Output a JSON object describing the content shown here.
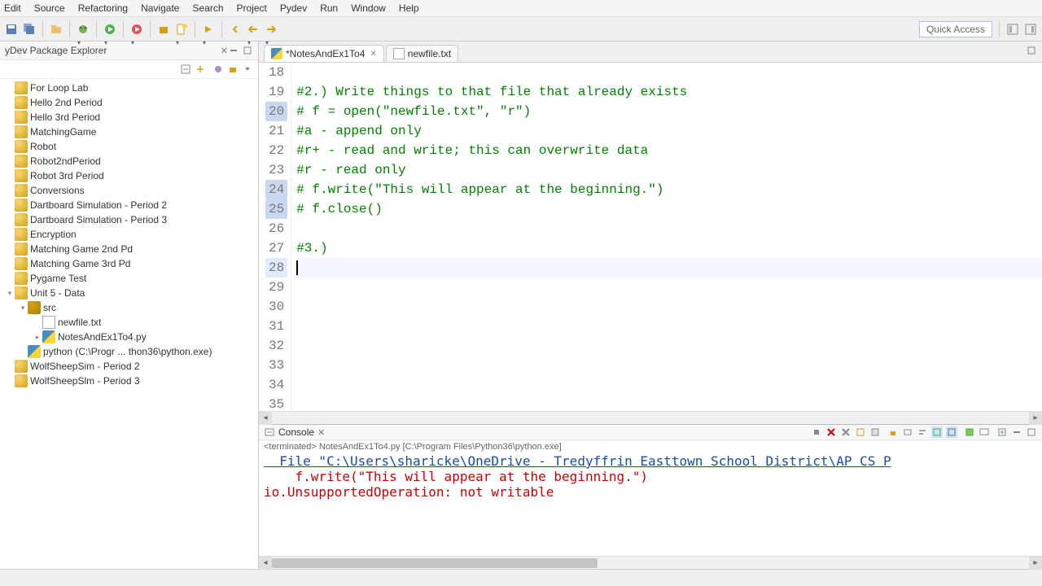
{
  "menu": [
    "Edit",
    "Source",
    "Refactoring",
    "Navigate",
    "Search",
    "Project",
    "Pydev",
    "Run",
    "Window",
    "Help"
  ],
  "quick_access": "Quick Access",
  "sidebar": {
    "title": "yDev Package Explorer",
    "items": [
      {
        "label": "For Loop Lab",
        "icon": "folder"
      },
      {
        "label": "Hello 2nd Period",
        "icon": "folder"
      },
      {
        "label": "Hello 3rd Period",
        "icon": "folder"
      },
      {
        "label": "MatchingGame",
        "icon": "folder"
      },
      {
        "label": "Robot",
        "icon": "folder"
      },
      {
        "label": "Robot2ndPeriod",
        "icon": "folder"
      },
      {
        "label": "Robot 3rd Period",
        "icon": "folder"
      },
      {
        "label": "Conversions",
        "icon": "folder"
      },
      {
        "label": "Dartboard Simulation - Period 2",
        "icon": "folder"
      },
      {
        "label": "Dartboard Simulation - Period 3",
        "icon": "folder"
      },
      {
        "label": "Encryption",
        "icon": "folder"
      },
      {
        "label": "Matching Game 2nd Pd",
        "icon": "folder"
      },
      {
        "label": "Matching Game 3rd Pd",
        "icon": "folder"
      },
      {
        "label": "Pygame Test",
        "icon": "folder"
      },
      {
        "label": "Unit 5 - Data",
        "icon": "folder",
        "expanded": true,
        "children": [
          {
            "label": "src",
            "icon": "pkg",
            "indent": 1,
            "expanded": true,
            "children": [
              {
                "label": "newfile.txt",
                "icon": "file",
                "indent": 2
              },
              {
                "label": "NotesAndEx1To4.py",
                "icon": "py",
                "indent": 2,
                "twisty": true
              }
            ]
          },
          {
            "label": "python  (C:\\Progr ... thon36\\python.exe)",
            "icon": "py",
            "indent": 1
          }
        ]
      },
      {
        "label": "WolfSheepSim - Period 2",
        "icon": "folder"
      },
      {
        "label": "WolfSheepSlm - Period 3",
        "icon": "folder"
      }
    ]
  },
  "tabs": [
    {
      "label": "*NotesAndEx1To4",
      "icon": "py",
      "active": true
    },
    {
      "label": "newfile.txt",
      "icon": "file",
      "active": false
    }
  ],
  "editor": {
    "first_line": 18,
    "highlighted_lines": [
      20,
      24,
      25
    ],
    "current_line": 28,
    "lines": [
      "",
      "#2.) Write things to that file that already exists",
      "# f = open(\"newfile.txt\", \"r\")",
      "#a - append only",
      "#r+ - read and write; this can overwrite data",
      "#r - read only",
      "# f.write(\"This will appear at the beginning.\")",
      "# f.close()",
      "",
      "#3.)",
      "",
      "",
      "",
      "",
      "",
      "",
      "",
      ""
    ]
  },
  "console": {
    "title": "Console",
    "sub": "<terminated> NotesAndEx1To4.py [C:\\Program Files\\Python36\\python.exe]",
    "lines": [
      {
        "text": "  File \"C:\\Users\\sharicke\\OneDrive - Tredyffrin Easttown School District\\AP CS P",
        "link": true
      },
      {
        "text": "    f.write(\"This will appear at the beginning.\")",
        "link": false
      },
      {
        "text": "io.UnsupportedOperation: not writable",
        "link": false
      }
    ]
  }
}
